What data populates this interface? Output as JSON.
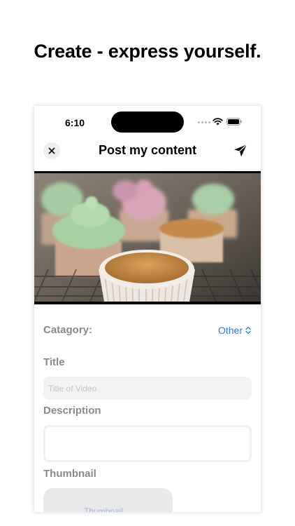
{
  "headline": "Create - express yourself.",
  "status_bar": {
    "time": "6:10",
    "icons": [
      "signal-dots-icon",
      "wifi-icon",
      "battery-icon"
    ]
  },
  "nav": {
    "title": "Post my content",
    "close_icon": "close-icon",
    "send_icon": "send-icon"
  },
  "video": {
    "description_icon": "video-preview"
  },
  "form": {
    "category_label": "Catagory:",
    "category_value": "Other",
    "title_label": "Title",
    "title_placeholder": "Title of Video",
    "title_value": "",
    "description_label": "Description",
    "description_value": "",
    "thumbnail_label": "Thumbnail",
    "thumbnail_button": "Thumbnail"
  },
  "colors": {
    "accent": "#2f7fd1",
    "label": "#8a8a8e",
    "field_bg": "#f3f3f5"
  }
}
